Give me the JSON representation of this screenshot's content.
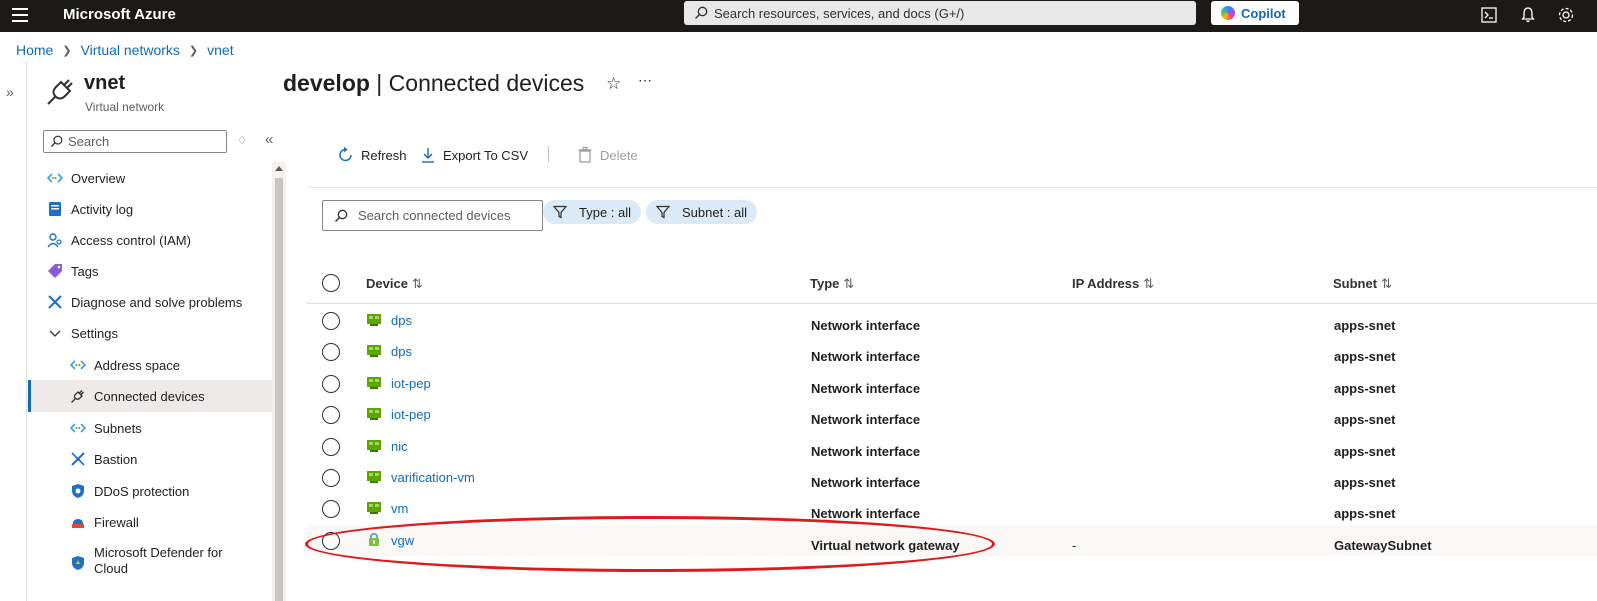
{
  "topbar": {
    "brand": "Microsoft Azure",
    "search_placeholder": "Search resources, services, and docs (G+/)",
    "copilot_label": "Copilot"
  },
  "breadcrumb": [
    "Home",
    "Virtual networks",
    "vnet"
  ],
  "resource": {
    "name": "vnet",
    "type": "Virtual network"
  },
  "menu": {
    "search_placeholder": "Search",
    "items": [
      {
        "label": "Overview",
        "icon": "vnet-icon"
      },
      {
        "label": "Activity log",
        "icon": "activity-log-icon"
      },
      {
        "label": "Access control (IAM)",
        "icon": "iam-icon"
      },
      {
        "label": "Tags",
        "icon": "tag-icon"
      },
      {
        "label": "Diagnose and solve problems",
        "icon": "diagnose-icon"
      },
      {
        "label": "Settings",
        "icon": "chevron-down-icon"
      },
      {
        "label": "Address space",
        "icon": "address-space-icon"
      },
      {
        "label": "Connected devices",
        "icon": "plug-icon"
      },
      {
        "label": "Subnets",
        "icon": "subnet-icon"
      },
      {
        "label": "Bastion",
        "icon": "bastion-icon"
      },
      {
        "label": "DDoS protection",
        "icon": "shield-icon"
      },
      {
        "label": "Firewall",
        "icon": "firewall-icon"
      },
      {
        "label": "Microsoft Defender for",
        "label2": "Cloud",
        "icon": "defender-icon"
      }
    ]
  },
  "page": {
    "title_bold": "develop",
    "title_rest": " | Connected devices"
  },
  "toolbar": {
    "refresh": "Refresh",
    "export": "Export To CSV",
    "delete": "Delete"
  },
  "filters": {
    "search_placeholder": "Search connected devices",
    "type_pill": "Type : all",
    "subnet_pill": "Subnet : all"
  },
  "grid": {
    "columns": [
      "Device",
      "Type",
      "IP Address",
      "Subnet"
    ],
    "rows": [
      {
        "device": "dps",
        "type": "Network interface",
        "ip": "",
        "subnet": "apps-snet",
        "icon": "nic-icon"
      },
      {
        "device": "dps",
        "type": "Network interface",
        "ip": "",
        "subnet": "apps-snet",
        "icon": "nic-icon"
      },
      {
        "device": "iot-pep",
        "type": "Network interface",
        "ip": "",
        "subnet": "apps-snet",
        "icon": "nic-icon"
      },
      {
        "device": "iot-pep",
        "type": "Network interface",
        "ip": "",
        "subnet": "apps-snet",
        "icon": "nic-icon"
      },
      {
        "device": "nic",
        "type": "Network interface",
        "ip": "",
        "subnet": "apps-snet",
        "icon": "nic-icon"
      },
      {
        "device": "varification-vm",
        "type": "Network interface",
        "ip": "",
        "subnet": "apps-snet",
        "icon": "nic-icon"
      },
      {
        "device": "vm",
        "type": "Network interface",
        "ip": "",
        "subnet": "apps-snet",
        "icon": "nic-icon"
      },
      {
        "device": "vgw",
        "type": "Virtual network gateway",
        "ip": "-",
        "subnet": "GatewaySubnet",
        "icon": "gateway-icon"
      }
    ]
  },
  "colors": {
    "accent": "#0f6cbd",
    "topbar": "#1b1a19",
    "annotation": "#e0191d",
    "pill": "#dbeaf7"
  }
}
